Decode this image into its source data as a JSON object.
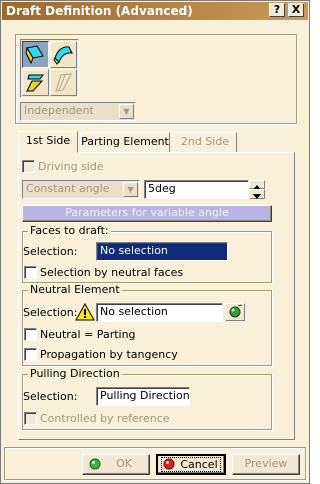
{
  "window": {
    "title": "Draft Definition (Advanced)",
    "help_button": "?",
    "close_button": "X"
  },
  "mode_combo": {
    "value": "Independent"
  },
  "tabs": [
    {
      "label": "1st Side"
    },
    {
      "label": "Parting Element"
    },
    {
      "label": "2nd Side"
    }
  ],
  "first_side": {
    "driving_side_label": "Driving side",
    "angle_type": "Constant angle",
    "angle_value": "5deg",
    "variable_angle_button": "Parameters for variable angle"
  },
  "faces_to_draft": {
    "title": "Faces to draft:",
    "selection_label": "Selection:",
    "selection_value": "No selection",
    "neutral_faces_label": "Selection by neutral faces"
  },
  "neutral_element": {
    "title": "Neutral Element",
    "selection_label": "Selection:",
    "selection_value": "No selection",
    "neutral_parting_label": "Neutral = Parting",
    "propagation_label": "Propagation by tangency"
  },
  "pulling_direction": {
    "title": "Pulling Direction",
    "selection_label": "Selection:",
    "selection_value": "Pulling Direction",
    "controlled_label": "Controlled by reference"
  },
  "buttons": {
    "ok": "OK",
    "cancel": "Cancel",
    "preview": "Preview"
  },
  "colors": {
    "dialog_bg": "#f8f0d8",
    "title_bar": "#9c6a2e",
    "selection_highlight": "#102a78",
    "variable_angle_button": "#b8b4e4"
  },
  "icons": [
    "draft-basic-icon",
    "draft-reflect-icon",
    "draft-variable-icon",
    "draft-parting-icon",
    "warning-icon",
    "select-element-icon",
    "ok-icon",
    "cancel-icon"
  ]
}
